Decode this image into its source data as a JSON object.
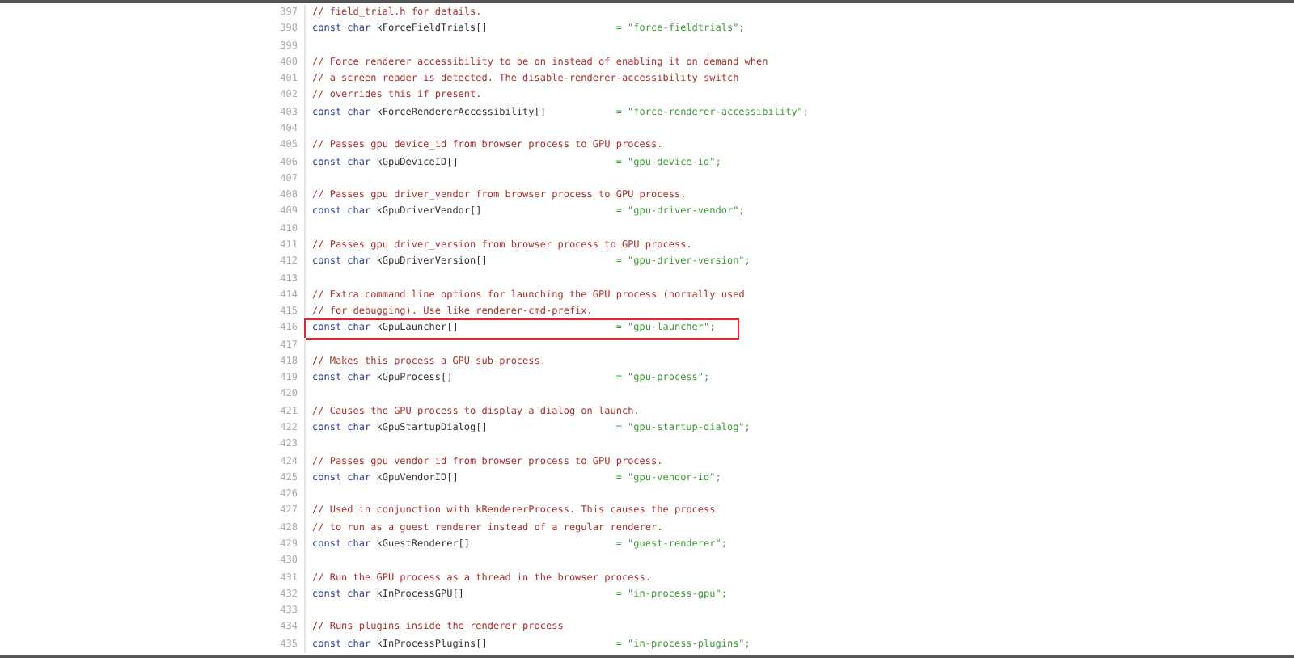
{
  "lines": [
    {
      "number": "397",
      "kind": "comment",
      "text": "// field_trial.h for details.",
      "highlighted": false
    },
    {
      "number": "398",
      "kind": "decl",
      "type": "const char",
      "name": "kForceFieldTrials[]",
      "value": "= \"force-fieldtrials\";",
      "highlighted": false
    },
    {
      "number": "399",
      "kind": "blank",
      "highlighted": false
    },
    {
      "number": "400",
      "kind": "comment",
      "text": "// Force renderer accessibility to be on instead of enabling it on demand when",
      "highlighted": false
    },
    {
      "number": "401",
      "kind": "comment",
      "text": "// a screen reader is detected. The disable-renderer-accessibility switch",
      "highlighted": false
    },
    {
      "number": "402",
      "kind": "comment",
      "text": "// overrides this if present.",
      "highlighted": false
    },
    {
      "number": "403",
      "kind": "decl",
      "type": "const char",
      "name": "kForceRendererAccessibility[]",
      "value": "= \"force-renderer-accessibility\";",
      "highlighted": false
    },
    {
      "number": "404",
      "kind": "blank",
      "highlighted": false
    },
    {
      "number": "405",
      "kind": "comment",
      "text": "// Passes gpu device_id from browser process to GPU process.",
      "highlighted": false
    },
    {
      "number": "406",
      "kind": "decl",
      "type": "const char",
      "name": "kGpuDeviceID[]",
      "value": "= \"gpu-device-id\";",
      "highlighted": false
    },
    {
      "number": "407",
      "kind": "blank",
      "highlighted": false
    },
    {
      "number": "408",
      "kind": "comment",
      "text": "// Passes gpu driver_vendor from browser process to GPU process.",
      "highlighted": false
    },
    {
      "number": "409",
      "kind": "decl",
      "type": "const char",
      "name": "kGpuDriverVendor[]",
      "value": "= \"gpu-driver-vendor\";",
      "highlighted": false
    },
    {
      "number": "410",
      "kind": "blank",
      "highlighted": false
    },
    {
      "number": "411",
      "kind": "comment",
      "text": "// Passes gpu driver_version from browser process to GPU process.",
      "highlighted": false
    },
    {
      "number": "412",
      "kind": "decl",
      "type": "const char",
      "name": "kGpuDriverVersion[]",
      "value": "= \"gpu-driver-version\";",
      "highlighted": false
    },
    {
      "number": "413",
      "kind": "blank",
      "highlighted": false
    },
    {
      "number": "414",
      "kind": "comment",
      "text": "// Extra command line options for launching the GPU process (normally used",
      "highlighted": false
    },
    {
      "number": "415",
      "kind": "comment",
      "text": "// for debugging). Use like renderer-cmd-prefix.",
      "highlighted": false
    },
    {
      "number": "416",
      "kind": "decl",
      "type": "const char",
      "name": "kGpuLauncher[]",
      "value": "= \"gpu-launcher\";",
      "highlighted": true
    },
    {
      "number": "417",
      "kind": "blank",
      "highlighted": false
    },
    {
      "number": "418",
      "kind": "comment",
      "text": "// Makes this process a GPU sub-process.",
      "highlighted": false
    },
    {
      "number": "419",
      "kind": "decl",
      "type": "const char",
      "name": "kGpuProcess[]",
      "value": "= \"gpu-process\";",
      "highlighted": false
    },
    {
      "number": "420",
      "kind": "blank",
      "highlighted": false
    },
    {
      "number": "421",
      "kind": "comment",
      "text": "// Causes the GPU process to display a dialog on launch.",
      "highlighted": false
    },
    {
      "number": "422",
      "kind": "decl",
      "type": "const char",
      "name": "kGpuStartupDialog[]",
      "value": "= \"gpu-startup-dialog\";",
      "highlighted": false
    },
    {
      "number": "423",
      "kind": "blank",
      "highlighted": false
    },
    {
      "number": "424",
      "kind": "comment",
      "text": "// Passes gpu vendor_id from browser process to GPU process.",
      "highlighted": false
    },
    {
      "number": "425",
      "kind": "decl",
      "type": "const char",
      "name": "kGpuVendorID[]",
      "value": "= \"gpu-vendor-id\";",
      "highlighted": false
    },
    {
      "number": "426",
      "kind": "blank",
      "highlighted": false
    },
    {
      "number": "427",
      "kind": "comment",
      "text": "// Used in conjunction with kRendererProcess. This causes the process",
      "highlighted": false
    },
    {
      "number": "428",
      "kind": "comment",
      "text": "// to run as a guest renderer instead of a regular renderer.",
      "highlighted": false
    },
    {
      "number": "429",
      "kind": "decl",
      "type": "const char",
      "name": "kGuestRenderer[]",
      "value": "= \"guest-renderer\";",
      "highlighted": false
    },
    {
      "number": "430",
      "kind": "blank",
      "highlighted": false
    },
    {
      "number": "431",
      "kind": "comment",
      "text": "// Run the GPU process as a thread in the browser process.",
      "highlighted": false
    },
    {
      "number": "432",
      "kind": "decl",
      "type": "const char",
      "name": "kInProcessGPU[]",
      "value": "= \"in-process-gpu\";",
      "highlighted": false
    },
    {
      "number": "433",
      "kind": "blank",
      "highlighted": false
    },
    {
      "number": "434",
      "kind": "comment",
      "text": "// Runs plugins inside the renderer process",
      "highlighted": false
    },
    {
      "number": "435",
      "kind": "decl",
      "type": "const char",
      "name": "kInProcessPlugins[]",
      "value": "= \"in-process-plugins\";",
      "highlighted": false
    }
  ]
}
